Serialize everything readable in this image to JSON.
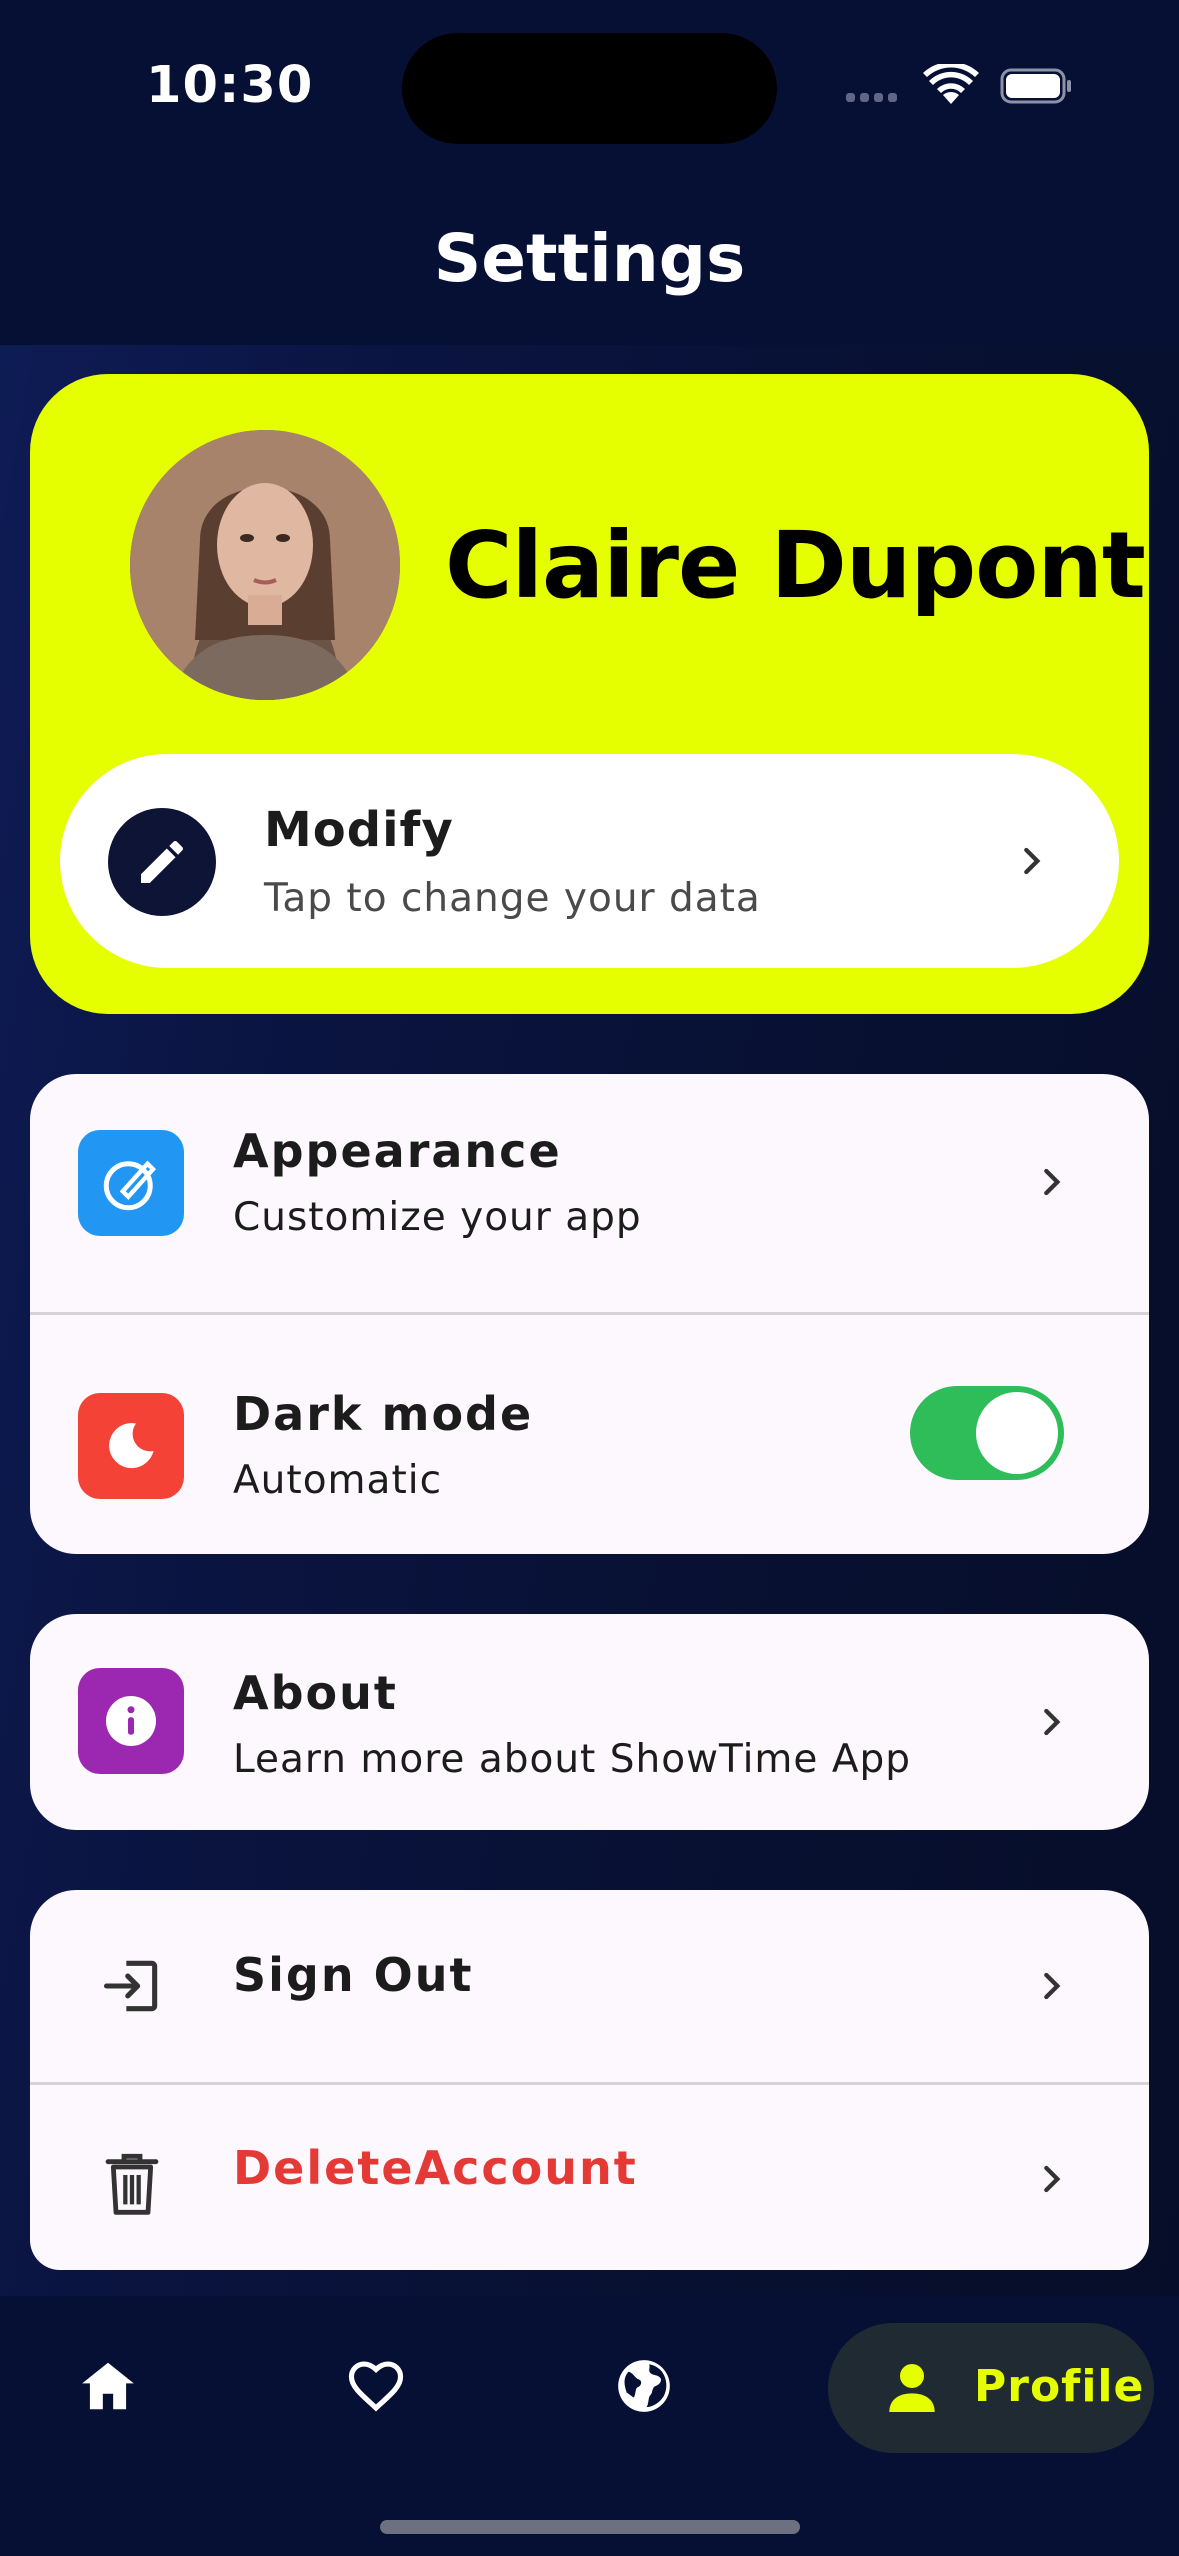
{
  "status_bar": {
    "time": "10:30"
  },
  "header": {
    "title": "Settings"
  },
  "profile": {
    "name": "Claire Dupont",
    "modify_title": "Modify",
    "modify_subtitle": "Tap to change your data"
  },
  "settings": {
    "appearance": {
      "title": "Appearance",
      "subtitle": "Customize your app",
      "icon": "palette-icon",
      "color": "#2196f3"
    },
    "dark_mode": {
      "title": "Dark mode",
      "subtitle": "Automatic",
      "icon": "moon-icon",
      "color": "#f44336",
      "enabled": true
    },
    "about": {
      "title": "About",
      "subtitle": "Learn more about ShowTime App",
      "icon": "info-icon",
      "color": "#9c27b0"
    },
    "sign_out": {
      "title": "Sign Out",
      "icon": "sign-out-icon"
    },
    "delete_account": {
      "title": "DeleteAccount",
      "icon": "trash-icon",
      "color": "#e53935"
    }
  },
  "bottom_nav": {
    "items": [
      {
        "name": "home",
        "icon": "home-icon"
      },
      {
        "name": "favorites",
        "icon": "heart-icon"
      },
      {
        "name": "explore",
        "icon": "globe-icon"
      },
      {
        "name": "profile",
        "icon": "person-icon",
        "label": "Profile",
        "active": true
      }
    ]
  },
  "colors": {
    "accent": "#e6ff00",
    "background": "#061034",
    "toggle_on": "#2ebd59"
  }
}
